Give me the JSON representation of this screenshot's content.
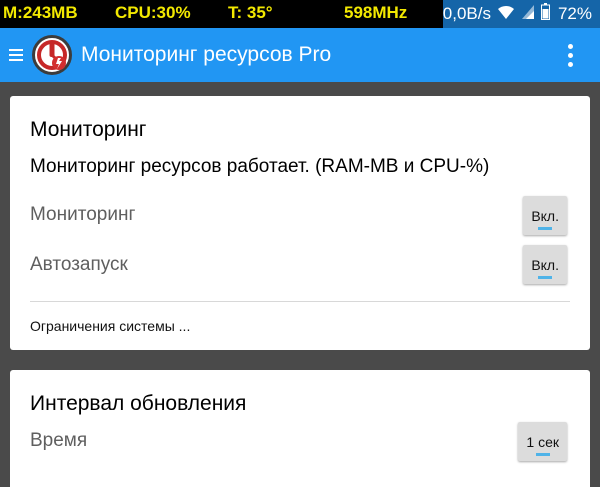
{
  "status_bar": {
    "ram": "M:243MB",
    "cpu": "CPU:30%",
    "temp": "T: 35°",
    "freq": "598MHz",
    "net_speed": "0,0B/s",
    "battery": "72%",
    "icons": [
      "wifi-icon",
      "signal-icon",
      "battery-icon"
    ]
  },
  "app_bar": {
    "title": "Мониторинг ресурсов Pro",
    "icons": [
      "menu-icon",
      "app-logo-icon",
      "overflow-menu-icon"
    ]
  },
  "monitoring_card": {
    "title": "Мониторинг",
    "status": "Мониторинг ресурсов работает. (RAM-MB и CPU-%)",
    "rows": [
      {
        "label": "Мониторинг",
        "button": "Вкл."
      },
      {
        "label": "Автозапуск",
        "button": "Вкл."
      }
    ],
    "limits_link": "Ограничения системы ..."
  },
  "interval_card": {
    "title": "Интервал обновления",
    "time_label": "Время",
    "time_value": "1 сек"
  },
  "colors": {
    "app_bar": "#2196f3",
    "status_bar_right": "#1565a8",
    "status_text": "#f2e800",
    "background": "#4a4a4a",
    "button_indicator": "#4fb3e8"
  }
}
